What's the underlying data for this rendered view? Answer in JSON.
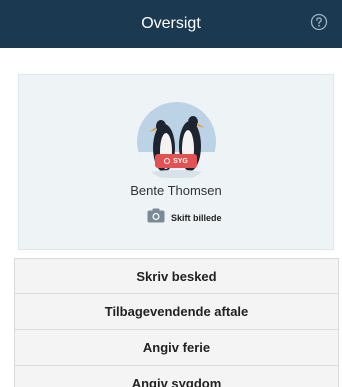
{
  "header": {
    "title": "Oversigt",
    "help_icon": "question-circle-icon",
    "background": "#1b3a52"
  },
  "profile": {
    "name": "Bente Thomsen",
    "status_label": "SYG",
    "status_color": "#e25252",
    "change_photo_label": "Skift billede",
    "camera_icon": "camera-icon"
  },
  "actions": [
    {
      "label": "Skriv besked"
    },
    {
      "label": "Tilbagevendende aftale"
    },
    {
      "label": "Angiv ferie"
    },
    {
      "label": "Angiv sygdom"
    }
  ]
}
